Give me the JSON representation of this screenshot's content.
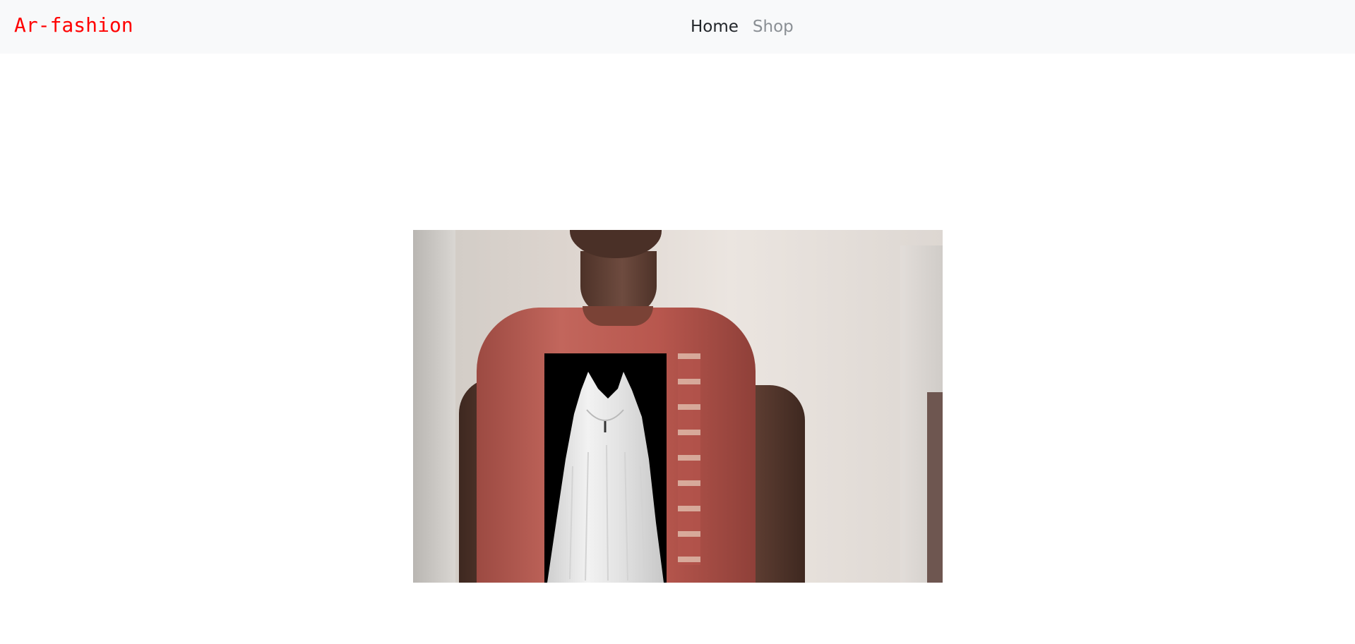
{
  "navbar": {
    "brand": "Ar-fashion",
    "brand_color": "#ff0000",
    "links": [
      {
        "label": "Home",
        "active": true
      },
      {
        "label": "Shop",
        "active": false
      }
    ]
  },
  "main": {
    "video_feed": {
      "icon": "webcam-feed",
      "overlay_icon": "dress-overlay"
    }
  }
}
